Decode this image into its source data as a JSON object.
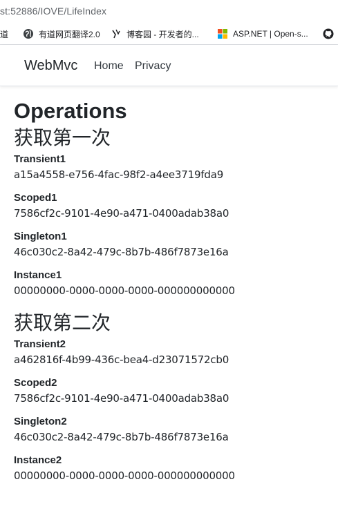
{
  "browser": {
    "address_host": "st:52886",
    "address_path": "/IOVE/LifeIndex"
  },
  "bookmarks": [
    {
      "label": "道",
      "icon": "bookmark-icon"
    },
    {
      "label": "有道网页翻译2.0",
      "icon": "globe-icon"
    },
    {
      "label": "博客园 - 开发者的...",
      "icon": "cnblogs-icon"
    },
    {
      "label": "ASP.NET | Open-s...",
      "icon": "windows-logo-icon"
    },
    {
      "label": "",
      "icon": "github-icon"
    }
  ],
  "navbar": {
    "brand": "WebMvc",
    "links": [
      "Home",
      "Privacy"
    ]
  },
  "page": {
    "title": "Operations",
    "first_heading": "获取第一次",
    "second_heading": "获取第二次",
    "first": [
      {
        "label": "Transient1",
        "value": "a15a4558-e756-4fac-98f2-a4ee3719fda9"
      },
      {
        "label": "Scoped1",
        "value": "7586cf2c-9101-4e90-a471-0400adab38a0"
      },
      {
        "label": "Singleton1",
        "value": "46c030c2-8a42-479c-8b7b-486f7873e16a"
      },
      {
        "label": "Instance1",
        "value": "00000000-0000-0000-0000-000000000000"
      }
    ],
    "second": [
      {
        "label": "Transient2",
        "value": "a462816f-4b99-436c-bea4-d23071572cb0"
      },
      {
        "label": "Scoped2",
        "value": "7586cf2c-9101-4e90-a471-0400adab38a0"
      },
      {
        "label": "Singleton2",
        "value": "46c030c2-8a42-479c-8b7b-486f7873e16a"
      },
      {
        "label": "Instance2",
        "value": "00000000-0000-0000-0000-000000000000"
      }
    ]
  },
  "colors": {
    "text": "#212529",
    "nav_link": "#343a40",
    "address": "#5f6368",
    "windows_red": "#f25022",
    "windows_green": "#7fba00",
    "windows_blue": "#00a4ef",
    "windows_yellow": "#ffb900"
  }
}
